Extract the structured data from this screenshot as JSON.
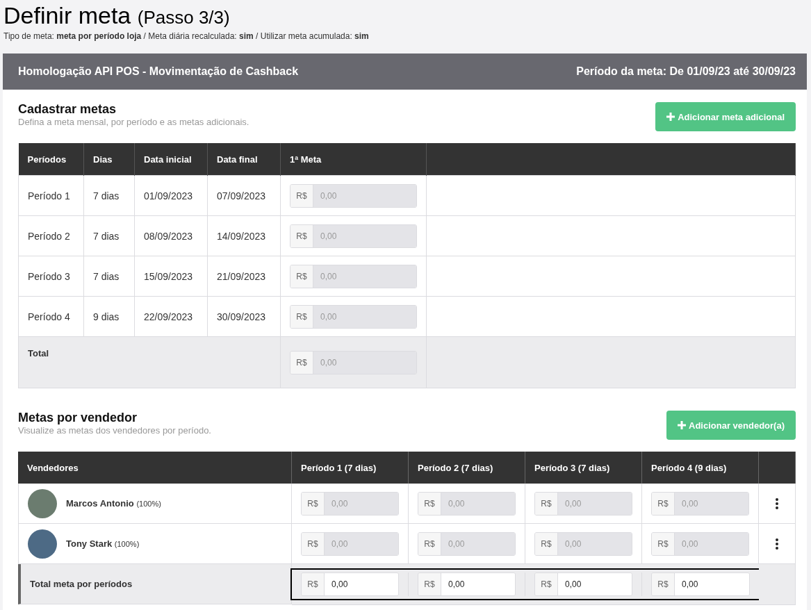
{
  "page": {
    "title": "Definir meta",
    "step": "(Passo 3/3)",
    "summary": "Tipo de meta: **meta por período loja** / Meta diária recalculada: **sim** / Utilizar meta acumulada: **sim**"
  },
  "banner": {
    "name": "Homologação API POS - Movimentação de Cashback",
    "period": "Período da meta: De 01/09/23 até 30/09/23"
  },
  "goals": {
    "title": "Cadastrar metas",
    "subtitle": "Defina a meta mensal, por período e as metas adicionais.",
    "add_button": "Adicionar meta adicional",
    "table": {
      "columns": [
        "Períodos",
        "Dias",
        "Data inicial",
        "Data final",
        "1ª Meta"
      ],
      "rows": [
        {
          "period": "Período 1",
          "days": "7 dias",
          "start": "01/09/2023",
          "end": "07/09/2023",
          "goal": {
            "prefix": "R$",
            "value": "0,00",
            "disabled": true
          }
        },
        {
          "period": "Período 2",
          "days": "7 dias",
          "start": "08/09/2023",
          "end": "14/09/2023",
          "goal": {
            "prefix": "R$",
            "value": "0,00",
            "disabled": true
          }
        },
        {
          "period": "Período 3",
          "days": "7 dias",
          "start": "15/09/2023",
          "end": "21/09/2023",
          "goal": {
            "prefix": "R$",
            "value": "0,00",
            "disabled": true
          }
        },
        {
          "period": "Período 4",
          "days": "9 dias",
          "start": "22/09/2023",
          "end": "30/09/2023",
          "goal": {
            "prefix": "R$",
            "value": "0,00",
            "disabled": true
          }
        }
      ],
      "total": {
        "label": "Total",
        "goal": {
          "prefix": "R$",
          "value": "0,00",
          "disabled": true
        }
      }
    }
  },
  "sellers": {
    "title": "Metas por vendedor",
    "subtitle": "Visualize as metas dos vendedores por período.",
    "add_button": "Adicionar vendedor(a)",
    "table": {
      "columns": [
        "Vendedores",
        "Período 1 (7 dias)",
        "Período 2 (7 dias)",
        "Período 3 (7 dias)",
        "Período 4 (9 dias)"
      ],
      "rows": [
        {
          "name": "Marcos Antonio",
          "share": "(100%)",
          "goals": [
            {
              "prefix": "R$",
              "value": "0,00",
              "disabled": true
            },
            {
              "prefix": "R$",
              "value": "0,00",
              "disabled": true
            },
            {
              "prefix": "R$",
              "value": "0,00",
              "disabled": true
            },
            {
              "prefix": "R$",
              "value": "0,00",
              "disabled": true
            }
          ]
        },
        {
          "name": "Tony Stark",
          "share": "(100%)",
          "goals": [
            {
              "prefix": "R$",
              "value": "0,00",
              "disabled": true
            },
            {
              "prefix": "R$",
              "value": "0,00",
              "disabled": true
            },
            {
              "prefix": "R$",
              "value": "0,00",
              "disabled": true
            },
            {
              "prefix": "R$",
              "value": "0,00",
              "disabled": true
            }
          ]
        }
      ],
      "total": {
        "label": "Total meta por períodos",
        "highlighted": true,
        "goals": [
          {
            "prefix": "R$",
            "value": "0,00",
            "disabled": false
          },
          {
            "prefix": "R$",
            "value": "0,00",
            "disabled": false
          },
          {
            "prefix": "R$",
            "value": "0,00",
            "disabled": false
          },
          {
            "prefix": "R$",
            "value": "0,00",
            "disabled": false
          }
        ]
      }
    }
  }
}
